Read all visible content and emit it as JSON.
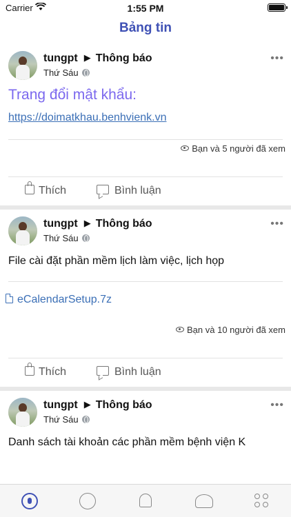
{
  "status_bar": {
    "carrier": "Carrier",
    "time": "1:55 PM"
  },
  "nav": {
    "title": "Bảng tin"
  },
  "posts": [
    {
      "author": "tungpt",
      "target": "Thông báo",
      "time": "Thứ Sáu",
      "title": "Trang đổi mật khẩu:",
      "link": "https://doimatkhau.benhvienk.vn",
      "views": "Bạn và 5 người đã xem",
      "like_label": "Thích",
      "comment_label": "Bình luận"
    },
    {
      "author": "tungpt",
      "target": "Thông báo",
      "time": "Thứ Sáu",
      "body": "File cài đặt phần mềm lịch làm việc, lịch họp",
      "attachment": "eCalendarSetup.7z",
      "views": "Bạn và 10 người đã xem",
      "like_label": "Thích",
      "comment_label": "Bình luận"
    },
    {
      "author": "tungpt",
      "target": "Thông báo",
      "time": "Thứ Sáu",
      "body": "Danh sách tài khoản các phần mềm bệnh viện K"
    }
  ],
  "tab_bar": {
    "icons": [
      "feed-icon",
      "chat-icon",
      "bell-icon",
      "people-icon",
      "apps-icon"
    ],
    "active_color": "#3f51b5",
    "inactive_color": "#888888"
  }
}
